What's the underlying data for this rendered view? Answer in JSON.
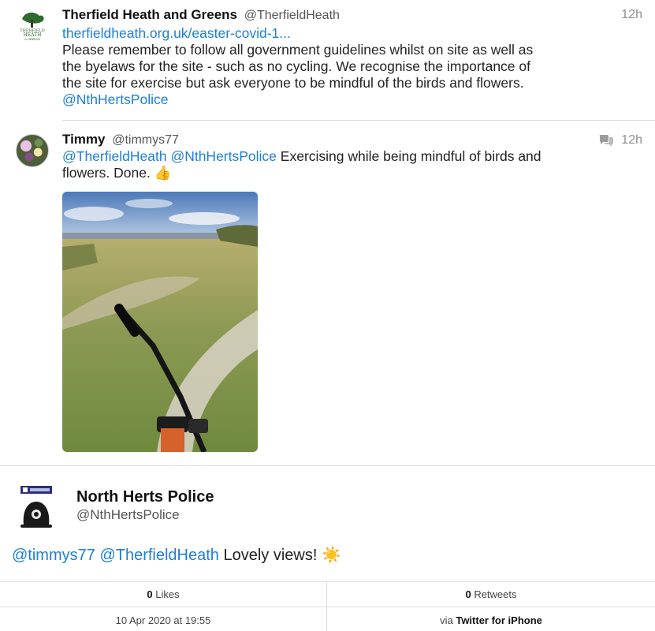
{
  "tweets": [
    {
      "name": "Therfield Heath and Greens",
      "handle": "@TherfieldHeath",
      "time": "12h",
      "avatar_icon": "therfield-heath-logo",
      "link": "therfieldheath.org.uk/easter-covid-1...",
      "lines": [
        "Please remember to follow all government guidelines whilst on site as well as",
        "the byelaws for the site - such as no cycling. We recognise the importance of",
        "the site for exercise but ask everyone to be mindful of the birds and flowers."
      ],
      "mention": "@NthHertsPolice"
    },
    {
      "name": "Timmy",
      "handle": "@timmys77",
      "time": "12h",
      "avatar_icon": "flower-avatar",
      "mention1": "@TherfieldHeath",
      "mention2": "@NthHertsPolice",
      "text_line1": " Exercising while being mindful of birds and",
      "text_line2": "flowers. Done. 👍",
      "photo_icon": "mountain-bike-on-heath-photo"
    }
  ],
  "focus": {
    "name": "North Herts Police",
    "handle": "@NthHertsPolice",
    "avatar_icon": "police-helmet-logo",
    "mention1": "@timmys77",
    "mention2": "@TherfieldHeath",
    "text": " Lovely views! ☀️"
  },
  "stats": {
    "likes_count": "0",
    "likes_label": " Likes",
    "retweets_count": "0",
    "retweets_label": " Retweets",
    "date": "10 Apr 2020 at 19:55",
    "via_prefix": "via ",
    "via_app": "Twitter for iPhone"
  },
  "colors": {
    "link": "#1d7fd4",
    "divider": "#dcdcdc"
  }
}
